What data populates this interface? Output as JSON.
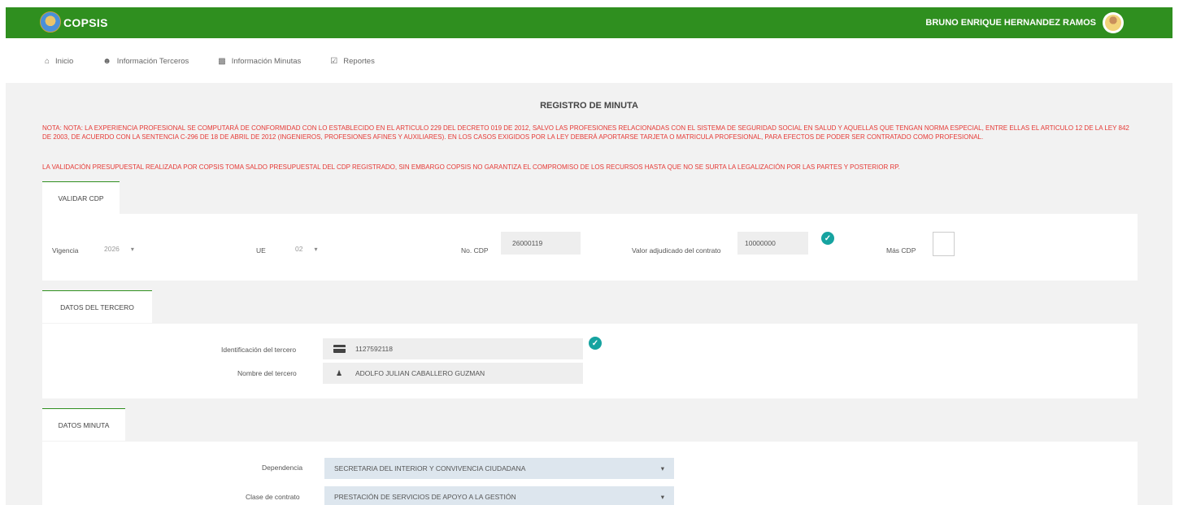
{
  "header": {
    "brand": "COPSIS",
    "user_name": "BRUNO ENRIQUE HERNANDEZ RAMOS"
  },
  "nav": {
    "items": [
      {
        "label": "Inicio",
        "icon": "home-icon"
      },
      {
        "label": "Información Terceros",
        "icon": "user-icon"
      },
      {
        "label": "Información Minutas",
        "icon": "book-icon"
      },
      {
        "label": "Reportes",
        "icon": "check-square-icon"
      }
    ]
  },
  "page": {
    "title": "REGISTRO DE MINUTA",
    "note": "NOTA: NOTA: LA EXPERIENCIA PROFESIONAL SE COMPUTARÁ DE CONFORMIDAD CON LO ESTABLECIDO EN EL ARTICULO 229 DEL DECRETO 019 DE 2012, SALVO LAS PROFESIONES RELACIONADAS CON EL SISTEMA DE SEGURIDAD SOCIAL EN SALUD Y AQUELLAS QUE TENGAN NORMA ESPECIAL, ENTRE ELLAS EL ARTICULO 12 DE LA LEY 842 DE 2003, DE ACUERDO CON LA SENTENCIA C-296 DE 18 DE ABRIL DE 2012 (INGENIEROS, PROFESIONES AFINES Y AUXILIARES). EN LOS CASOS EXIGIDOS POR LA LEY DEBERÁ APORTARSE TARJETA O MATRICULA PROFESIONAL, PARA EFECTOS DE PODER SER CONTRATADO COMO PROFESIONAL.",
    "validation_note": "LA VALIDACIÓN PRESUPUESTAL REALIZADA POR COPSIS TOMA SALDO PRESUPUESTAL DEL CDP REGISTRADO, SIN EMBARGO COPSIS NO GARANTIZA EL COMPROMISO DE LOS RECURSOS HASTA QUE NO SE SURTA LA LEGALIZACIÓN POR LAS PARTES Y POSTERIOR RP."
  },
  "validar_cdp": {
    "tab_label": "VALIDAR CDP",
    "vigencia_label": "Vigencia",
    "vigencia_value": "2026",
    "ue_label": "UE",
    "ue_value": "02",
    "no_cdp_label": "No. CDP",
    "no_cdp_value": "26000119",
    "valor_label": "Valor adjudicado del contrato",
    "valor_value": "10000000",
    "mas_cdp_label": "Más CDP"
  },
  "tercero": {
    "tab_label": "DATOS DEL TERCERO",
    "id_label": "Identificación del tercero",
    "id_value": "1127592118",
    "name_label": "Nombre del tercero",
    "name_value": "ADOLFO JULIAN CABALLERO GUZMAN"
  },
  "minuta": {
    "tab_label": "DATOS MINUTA",
    "dependencia_label": "Dependencia",
    "dependencia_value": "SECRETARIA DEL INTERIOR Y CONVIVENCIA CIUDADANA",
    "clase_label": "Clase de contrato",
    "clase_value": "PRESTACIÓN DE SERVICIOS DE APOYO A LA GESTIÓN"
  },
  "colors": {
    "header_green": "#2f8f1f",
    "note_red": "#e53935",
    "check_teal": "#16a3a0"
  }
}
